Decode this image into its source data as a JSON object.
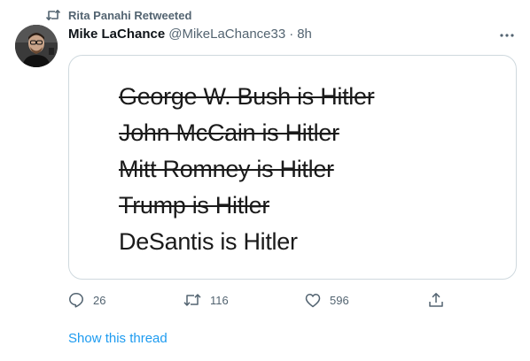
{
  "retweet": {
    "label": "Rita Panahi Retweeted",
    "icon": "retweet-icon"
  },
  "author": {
    "name": "Mike LaChance",
    "handle": "@MikeLaChance33",
    "separator": "·",
    "time": "8h"
  },
  "more_icon": "more-dots-icon",
  "meme": {
    "lines": [
      {
        "text": "George W. Bush is Hitler",
        "struck": true
      },
      {
        "text": "John McCain is Hitler",
        "struck": true
      },
      {
        "text": "Mitt Romney is Hitler",
        "struck": true
      },
      {
        "text": "Trump is Hitler",
        "struck": true
      },
      {
        "text": "DeSantis is Hitler",
        "struck": false
      }
    ]
  },
  "actions": {
    "reply": {
      "icon": "reply-icon",
      "count": "26"
    },
    "retweet": {
      "icon": "retweet-icon",
      "count": "116"
    },
    "like": {
      "icon": "like-icon",
      "count": "596"
    },
    "share": {
      "icon": "share-icon"
    }
  },
  "show_thread": "Show this thread",
  "colors": {
    "link": "#1d9bf0",
    "secondary_text": "#536471",
    "border": "#cfd9de"
  }
}
